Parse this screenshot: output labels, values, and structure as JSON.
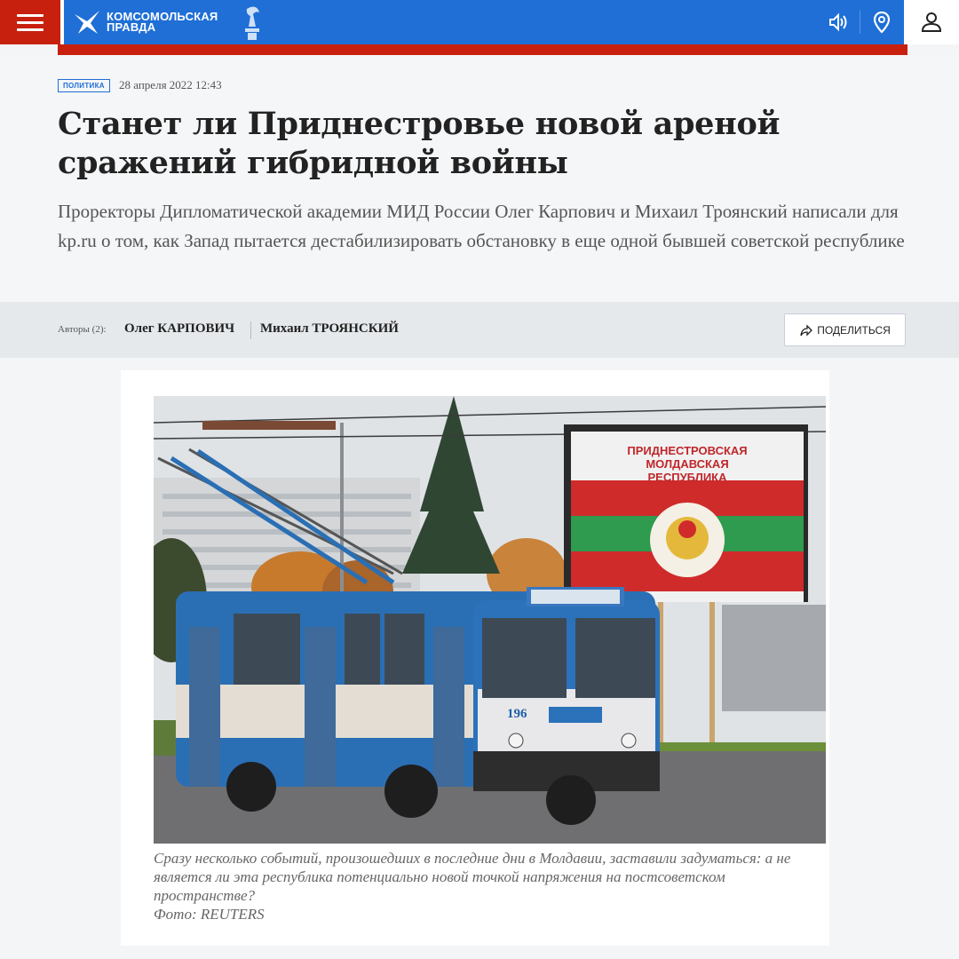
{
  "header": {
    "logo_line1": "КОМСОМОЛЬСКАЯ",
    "logo_line2": "ПРАВДА",
    "icons": [
      "menu-icon",
      "audio-icon",
      "location-pin-icon",
      "user-icon"
    ],
    "colors": {
      "red": "#c8200f",
      "blue": "#1f6fd6"
    }
  },
  "article": {
    "rubric": "ПОЛИТИКА",
    "date": "28 апреля 2022 12:43",
    "title": "Станет ли Приднестровье новой ареной сражений гибридной войны",
    "subtitle": "Проректоры Дипломатической академии МИД России Олег Карпович и Михаил Троянский написали для kp.ru о том, как Запад пытается дестабилизировать обстановку в еще одной бывшей советской республике"
  },
  "authors": {
    "label": "Авторы (2):",
    "names": [
      "Олег КАРПОВИЧ",
      "Михаил ТРОЯНСКИЙ"
    ],
    "share_label": "ПОДЕЛИТЬСЯ"
  },
  "photo": {
    "billboard_text": [
      "ПРИДНЕСТРОВСКАЯ",
      "МОЛДАВСКАЯ",
      "РЕСПУБЛИКА"
    ],
    "trolleybus_number": "196",
    "caption": "Сразу несколько событий, произошедших в последние дни в Молдавии, заставили задуматься: а не является ли эта республика потенциально новой точкой напряжения на постсоветском пространстве?",
    "credit": "Фото: REUTERS"
  }
}
